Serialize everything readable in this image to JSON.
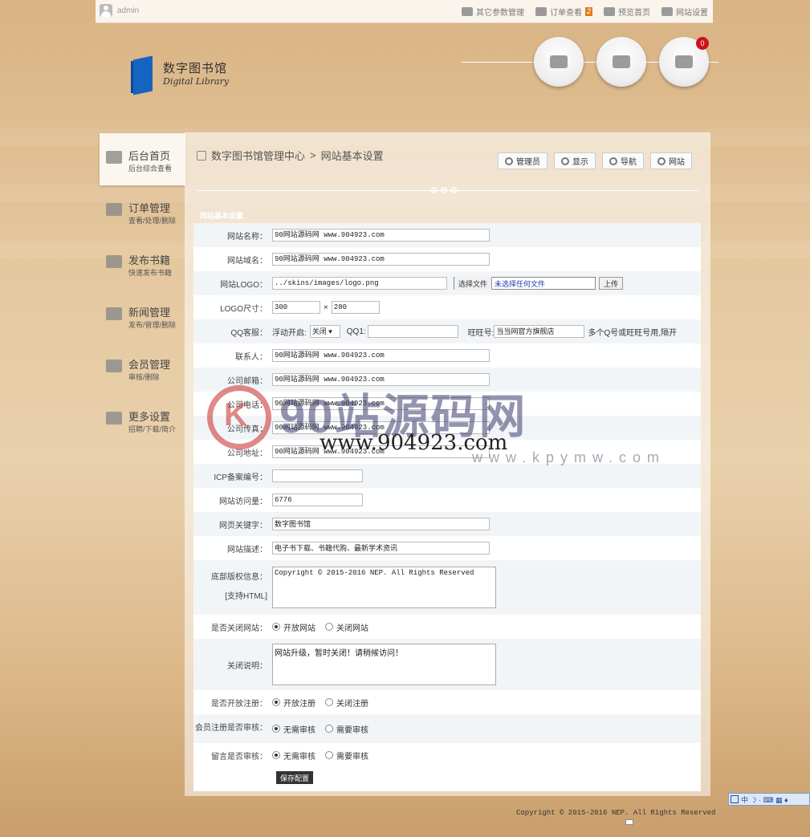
{
  "topbar": {
    "user": "admin",
    "nav": [
      {
        "label": "其它参数管理",
        "icon": "doc-icon"
      },
      {
        "label": "订单查看",
        "icon": "mail-icon",
        "badge": "2"
      },
      {
        "label": "预览首页",
        "icon": "cloud-icon"
      },
      {
        "label": "网站设置",
        "icon": "sliders-icon"
      }
    ]
  },
  "logo": {
    "title": "数字图书馆",
    "subtitle": "Digital Library"
  },
  "circles": [
    {
      "icon": "admin-icon"
    },
    {
      "icon": "truck-icon"
    },
    {
      "icon": "chat-icon",
      "count": "0"
    }
  ],
  "sidebar": [
    {
      "title": "后台首页",
      "sub": "后台综合查看",
      "icon": "presentation-icon"
    },
    {
      "title": "订单管理",
      "sub": "查看/处理/删除",
      "icon": "envelope-icon"
    },
    {
      "title": "发布书籍",
      "sub": "快速发布书籍",
      "icon": "edit-icon"
    },
    {
      "title": "新闻管理",
      "sub": "发布/管理/删除",
      "icon": "newspaper-icon"
    },
    {
      "title": "会员管理",
      "sub": "审核/删除",
      "icon": "users-icon"
    },
    {
      "title": "更多设置",
      "sub": "招聘/下载/简介",
      "icon": "chart-icon"
    }
  ],
  "breadcrumb": {
    "root": "数字图书馆管理中心",
    "sep": ">",
    "current": "网站基本设置"
  },
  "toolbar": [
    "管理员",
    "显示",
    "导航",
    "网站"
  ],
  "section_title": "网站基本设置",
  "form": {
    "site_name": {
      "label": "网站名称：",
      "value": "90网站源码网  www.904923.com"
    },
    "site_domain": {
      "label": "网站域名：",
      "value": "90网站源码网  www.904923.com"
    },
    "logo": {
      "label": "网站LOGO：",
      "value": "../skins/images/logo.png",
      "choose": "选择文件",
      "none": "未选择任何文件",
      "upload": "上传"
    },
    "logo_size": {
      "label": "LOGO尺寸：",
      "w": "300",
      "x": "×",
      "h": "280"
    },
    "qq": {
      "label": "QQ客服：",
      "float_label": "浮动开启:",
      "float_value": "关闭 ▾",
      "qq1_label": "QQ1:",
      "qq1_value": "",
      "ww_label": "旺旺号:",
      "ww_value": "当当网官方旗舰店",
      "hint": "多个Q号或旺旺号用,隔开"
    },
    "contact": {
      "label": "联系人：",
      "value": "90网站源码网  www.904923.com"
    },
    "email": {
      "label": "公司邮箱：",
      "value": "90网站源码网  www.904923.com"
    },
    "phone": {
      "label": "公司电话：",
      "value": "90网站源码网  www.904923.com"
    },
    "fax": {
      "label": "公司传真：",
      "value": "90网站源码网  www.904923.com"
    },
    "address": {
      "label": "公司地址：",
      "value": "90网站源码网  www.904923.com"
    },
    "icp": {
      "label": "ICP备案编号：",
      "value": ""
    },
    "visits": {
      "label": "网站访问量：",
      "value": "6776"
    },
    "keywords": {
      "label": "网页关键字：",
      "value": "数字图书馆"
    },
    "description": {
      "label": "网站描述：",
      "value": "电子书下载、书籍代购、最新学术资讯"
    },
    "copyright": {
      "label": "底部版权信息：",
      "label2": "[支持HTML]",
      "value": "Copyright © 2015-2016 NEP. All Rights Reserved"
    },
    "close_site": {
      "label": "是否关闭网站：",
      "opt1": "开放网站",
      "opt2": "关闭网站"
    },
    "close_note": {
      "label": "关闭说明：",
      "value": "网站升级，暂时关闭！请稍候访问！"
    },
    "open_reg": {
      "label": "是否开放注册：",
      "opt1": "开放注册",
      "opt2": "关闭注册"
    },
    "member_audit": {
      "label": "会员注册是否审核：",
      "opt1": "无需审核",
      "opt2": "需要审核"
    },
    "msg_audit": {
      "label": "留言是否审核：",
      "opt1": "无需审核",
      "opt2": "需要审核"
    },
    "save": "保存配置"
  },
  "footer": "Copyright © 2015-2016 NEP. All Rights Reserved",
  "watermark": {
    "text": "90站源码网",
    "url": "www.904923.com",
    "url2": "www.kpymw.com"
  },
  "ime": "中 ☽ · ⌨ ▦ ♦"
}
